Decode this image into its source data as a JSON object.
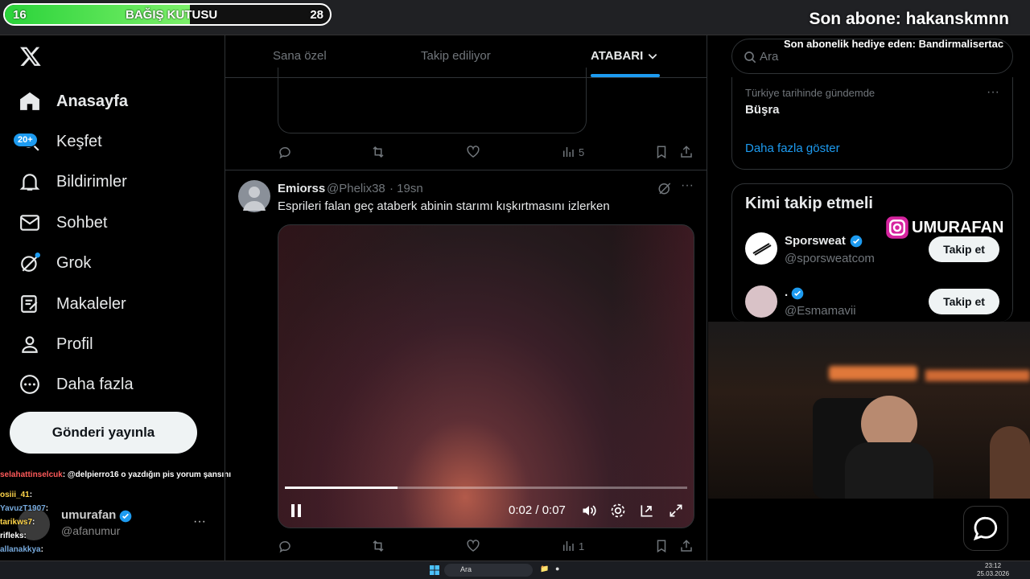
{
  "overlay": {
    "donation": {
      "left": "16",
      "label": "BAĞIŞ KUTUSU",
      "right": "28",
      "progress": 0.57
    },
    "last_sub": "Son abone: hakanskmnn",
    "last_gift": "Son abonelik hediye eden: Bandirmalisertac",
    "instagram": "UMURAFAN"
  },
  "nav": {
    "logo": "X",
    "items": [
      {
        "label": "Anasayfa",
        "icon": "home-icon"
      },
      {
        "label": "Keşfet",
        "icon": "search-icon"
      },
      {
        "label": "Bildirimler",
        "icon": "bell-icon"
      },
      {
        "label": "Sohbet",
        "icon": "mail-icon"
      },
      {
        "label": "Grok",
        "icon": "grok-icon"
      },
      {
        "label": "Makaleler",
        "icon": "article-icon"
      },
      {
        "label": "Profil",
        "icon": "person-icon"
      },
      {
        "label": "Daha fazla",
        "icon": "more-circle-icon"
      }
    ],
    "badge": "20+",
    "post_button": "Gönderi yayınla"
  },
  "account": {
    "name": "umurafan",
    "handle": "@afanumur",
    "more": "···"
  },
  "chat": [
    {
      "user": "selahattinselcuk",
      "text": ": @delpierro16 o yazdığın pis yorum şansını"
    },
    {
      "user": "osiii_41",
      "text": ":"
    },
    {
      "user": "YavuzT1907",
      "text": ":"
    },
    {
      "user": "tarikws7",
      "text": ":"
    },
    {
      "user": "rifleks",
      "text": ":"
    },
    {
      "user": "allanakkya",
      "text": ":"
    }
  ],
  "tabs": {
    "t1": "Sana özel",
    "t2": "Takip ediliyor",
    "t3": "ATABARI"
  },
  "prev_post": {
    "views": "5"
  },
  "post": {
    "name": "Emiorss",
    "handle": "@Phelix38",
    "time": "· 19sn",
    "text": "Esprileri falan geç ataberk abinin starımı kışkırtmasını izlerken",
    "video_time": "0:02 / 0:07",
    "video_progress": 0.28,
    "views": "1"
  },
  "right": {
    "search_placeholder": "Ara",
    "trend_context": "Türkiye tarihinde gündemde",
    "trend_name": "Büşra",
    "show_more": "Daha fazla göster",
    "who_to_follow": "Kimi takip etmeli",
    "suggestions": [
      {
        "name": "Sporsweat",
        "handle": "@sporsweatcom",
        "button": "Takip et"
      },
      {
        "name": ".",
        "handle": "@Esmamavii",
        "button": "Takip et"
      }
    ]
  },
  "taskbar": {
    "search": "Ara",
    "time": "23:12",
    "date": "25.03.2026"
  }
}
